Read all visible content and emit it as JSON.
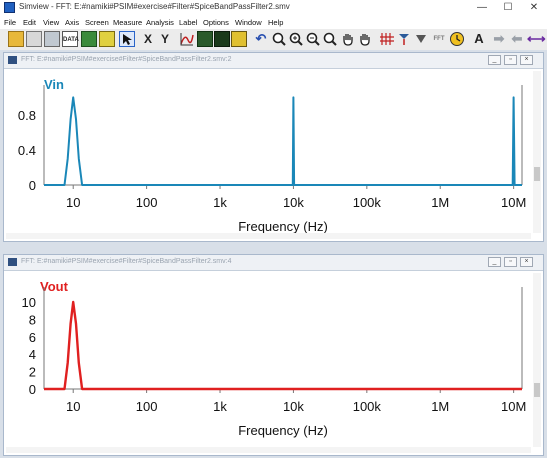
{
  "window": {
    "title": "Simview - FFT: E:#namiki#PSIM#exercise#Filter#SpiceBandPassFilter2.smv",
    "minimize": "—",
    "maximize": "☐",
    "close": "✕"
  },
  "menu": [
    "File",
    "Edit",
    "View",
    "Axis",
    "Screen",
    "Measure",
    "Analysis",
    "Label",
    "Options",
    "Window",
    "Help"
  ],
  "toolbar": {
    "data_label": "DATA",
    "x_label": "X",
    "y_label": "Y",
    "fft_label": "FFT",
    "text_label": "A"
  },
  "panels": [
    {
      "title": "FFT: E:#namiki#PSIM#exercise#Filter#SpiceBandPassFilter2.smv:2",
      "signal": "Vin",
      "color": "#1a87b8",
      "xlabel": "Frequency (Hz)",
      "yticks": [
        "0.8",
        "0.4",
        "0"
      ],
      "xticks": [
        "10",
        "100",
        "1k",
        "10k",
        "100k",
        "1M",
        "10M"
      ]
    },
    {
      "title": "FFT: E:#namiki#PSIM#exercise#Filter#SpiceBandPassFilter2.smv:4",
      "signal": "Vout",
      "color": "#e02020",
      "xlabel": "Frequency (Hz)",
      "yticks": [
        "10",
        "8",
        "6",
        "4",
        "2",
        "0"
      ],
      "xticks": [
        "10",
        "100",
        "1k",
        "10k",
        "100k",
        "1M",
        "10M"
      ]
    }
  ],
  "chart_data": [
    {
      "type": "line",
      "title": "Vin",
      "xlabel": "Frequency (Hz)",
      "ylabel": "",
      "xscale": "log",
      "xlim": [
        4,
        13000000
      ],
      "ylim": [
        0,
        1.05
      ],
      "yticks": [
        0,
        0.4,
        0.8
      ],
      "xticks": [
        10,
        100,
        1000,
        10000,
        100000,
        1000000,
        10000000
      ],
      "grid": false,
      "series": [
        {
          "name": "Vin",
          "color": "#1a87b8",
          "x": [
            4,
            7.6,
            8.4,
            9.2,
            10,
            10.9,
            11.9,
            13.2,
            9800,
            10000,
            10200,
            9700000,
            10000000,
            10300000,
            13000000
          ],
          "y": [
            0,
            0,
            0.3,
            0.75,
            1.0,
            0.75,
            0.3,
            0,
            0,
            1.0,
            0,
            0,
            1.0,
            0,
            0
          ]
        }
      ]
    },
    {
      "type": "line",
      "title": "Vout",
      "xlabel": "Frequency (Hz)",
      "ylabel": "",
      "xscale": "log",
      "xlim": [
        4,
        13000000
      ],
      "ylim": [
        0,
        10.8
      ],
      "yticks": [
        0,
        2,
        4,
        6,
        8,
        10
      ],
      "xticks": [
        10,
        100,
        1000,
        10000,
        100000,
        1000000,
        10000000
      ],
      "grid": false,
      "series": [
        {
          "name": "Vout",
          "color": "#e02020",
          "x": [
            4,
            7.6,
            8.4,
            9.2,
            10,
            10.9,
            11.9,
            13.2,
            13000000
          ],
          "y": [
            0,
            0,
            3.0,
            7.5,
            10.0,
            7.5,
            3.0,
            0,
            0
          ]
        }
      ]
    }
  ]
}
